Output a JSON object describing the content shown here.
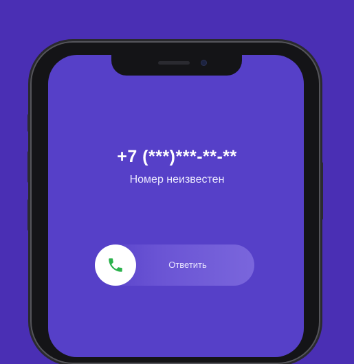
{
  "call": {
    "number": "+7 (***)***-**-**",
    "status": "Номер неизвестен",
    "answer_label": "Ответить"
  },
  "icons": {
    "answer": "phone-handset-icon"
  },
  "colors": {
    "background": "#4a2fb4",
    "screen": "#5640c8",
    "answer_icon": "#2bb24c"
  }
}
